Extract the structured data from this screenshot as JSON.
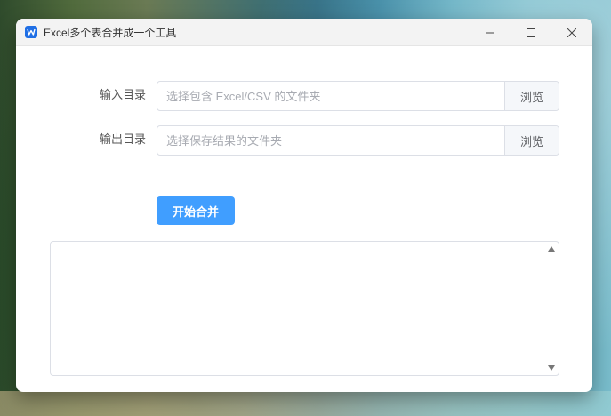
{
  "window": {
    "title": "Excel多个表合并成一个工具"
  },
  "form": {
    "input_dir": {
      "label": "输入目录",
      "placeholder": "选择包含 Excel/CSV 的文件夹",
      "value": "",
      "browse_label": "浏览"
    },
    "output_dir": {
      "label": "输出目录",
      "placeholder": "选择保存结果的文件夹",
      "value": "",
      "browse_label": "浏览"
    },
    "start_label": "开始合并"
  },
  "log": {
    "text": ""
  },
  "colors": {
    "primary": "#409eff",
    "app_icon": "#1f6fe5"
  },
  "icons": {
    "app": "word-w-icon",
    "minimize": "minimize-icon",
    "maximize": "maximize-icon",
    "close": "close-icon",
    "scroll_up": "triangle-up-icon",
    "scroll_down": "triangle-down-icon"
  }
}
